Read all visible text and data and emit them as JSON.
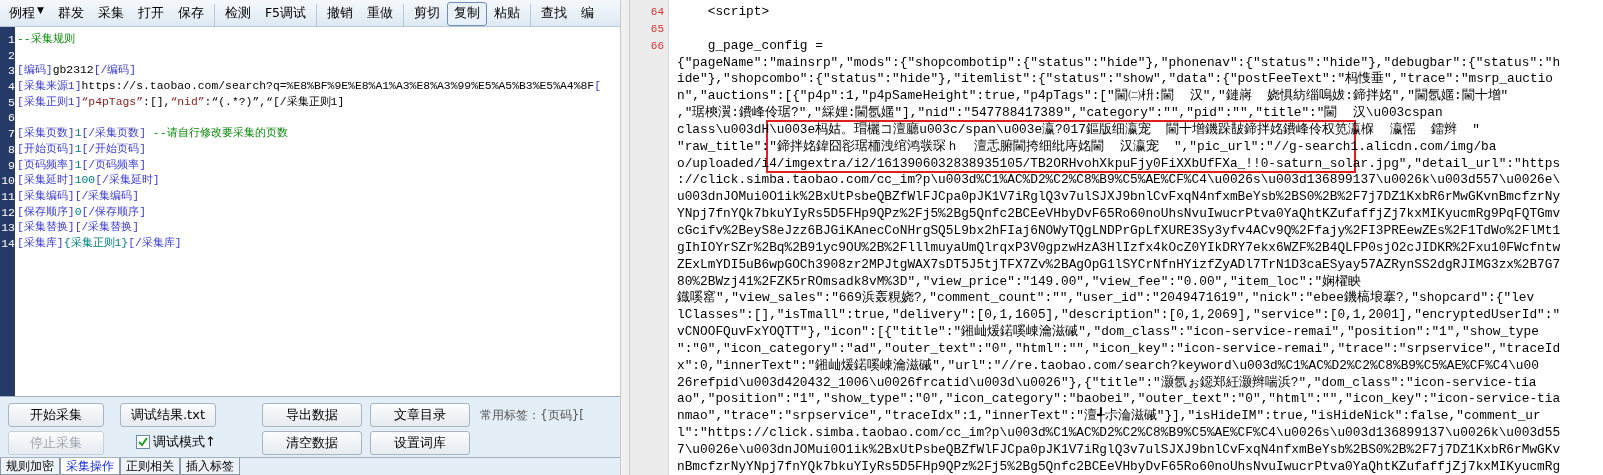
{
  "toolbar": [
    {
      "label": "例程",
      "selected": false,
      "dropdown": "▼"
    },
    {
      "label": "群发",
      "selected": false
    },
    {
      "label": "采集",
      "selected": false
    },
    {
      "label": "打开",
      "selected": false
    },
    {
      "label": "保存",
      "selected": false,
      "sep": true
    },
    {
      "label": "检测",
      "selected": false
    },
    {
      "label": "F5调试",
      "selected": false,
      "sep": true
    },
    {
      "label": "撤销",
      "selected": false
    },
    {
      "label": "重做",
      "selected": false,
      "sep": true
    },
    {
      "label": "剪切",
      "selected": false
    },
    {
      "label": "复制",
      "selected": true
    },
    {
      "label": "粘贴",
      "selected": false,
      "sep": true
    },
    {
      "label": "查找",
      "selected": false
    },
    {
      "label": "编",
      "selected": false
    }
  ],
  "rule_editor": {
    "lines": [
      {
        "number": "1",
        "segments": [
          {
            "kind": "comment",
            "text": "--采集规则"
          }
        ]
      },
      {
        "number": "2"
      },
      {
        "number": "3",
        "segments": [
          {
            "kind": "tag",
            "text": "[编码]"
          },
          {
            "kind": "text",
            "text": "gb2312"
          },
          {
            "kind": "tag",
            "text": "[/编码]"
          }
        ]
      },
      {
        "number": "4",
        "segments": [
          {
            "kind": "tag",
            "text": "[采集来源1]"
          },
          {
            "kind": "text",
            "text": "https://s.taobao.com/search?q=%E8%BF%9E%E8%A1%A3%E8%A3%99%E5%A5%B3%E5%A4%8F"
          },
          {
            "kind": "tag",
            "text": "["
          }
        ]
      },
      {
        "number": "5",
        "segments": [
          {
            "kind": "tag",
            "text": "[采集正则1]"
          },
          {
            "kind": "string",
            "text": "“p4pTags”"
          },
          {
            "kind": "text",
            "text": ":[],"
          },
          {
            "kind": "string",
            "text": "“nid”"
          },
          {
            "kind": "text",
            "text": ":“(.*?)”,“[/采集正则1]"
          }
        ]
      },
      {
        "number": "6"
      },
      {
        "number": "7",
        "segments": [
          {
            "kind": "tag",
            "text": "[采集页数]"
          },
          {
            "kind": "num",
            "text": "1"
          },
          {
            "kind": "tag",
            "text": "[/采集页数]"
          },
          {
            "kind": "comment",
            "text": " --请自行修改要采集的页数"
          }
        ]
      },
      {
        "number": "8",
        "segments": [
          {
            "kind": "tag",
            "text": "[开始页码]"
          },
          {
            "kind": "num",
            "text": "1"
          },
          {
            "kind": "tag",
            "text": "[/开始页码]"
          }
        ]
      },
      {
        "number": "9",
        "segments": [
          {
            "kind": "tag",
            "text": "[页码频率]"
          },
          {
            "kind": "num",
            "text": "1"
          },
          {
            "kind": "tag",
            "text": "[/页码频率]"
          }
        ]
      },
      {
        "number": "10",
        "segments": [
          {
            "kind": "tag",
            "text": "[采集延时]"
          },
          {
            "kind": "num",
            "text": "100"
          },
          {
            "kind": "tag",
            "text": "[/采集延时]"
          }
        ]
      },
      {
        "number": "11",
        "segments": [
          {
            "kind": "tag",
            "text": "[采集编码]"
          },
          {
            "kind": "tag",
            "text": "[/采集编码]"
          }
        ]
      },
      {
        "number": "12",
        "segments": [
          {
            "kind": "tag",
            "text": "[保存顺序]"
          },
          {
            "kind": "num",
            "text": "0"
          },
          {
            "kind": "tag",
            "text": "[/保存顺序]"
          }
        ]
      },
      {
        "number": "13",
        "segments": [
          {
            "kind": "tag",
            "text": "[采集替换]"
          },
          {
            "kind": "tag",
            "text": "[/采集替换]"
          }
        ]
      },
      {
        "number": "14",
        "segments": [
          {
            "kind": "tag",
            "text": "[采集库]"
          },
          {
            "kind": "num",
            "text": "{采集正则1}"
          },
          {
            "kind": "tag",
            "text": "[/采集库]"
          }
        ]
      }
    ]
  },
  "control_panel": {
    "run_buttons": [
      {
        "label": "开始采集",
        "disabled": false
      },
      {
        "label": "停止采集",
        "disabled": true
      }
    ],
    "debug_result_button": {
      "label": "调试结果.txt"
    },
    "data_buttons": [
      {
        "label": "导出数据"
      },
      {
        "label": "文章目录"
      },
      {
        "label": "清空数据"
      },
      {
        "label": "设置词库"
      }
    ],
    "debug_mode": {
      "label": "调试模式↑",
      "checked": true
    },
    "common_tags": "常用标签：{页码}["
  },
  "bottom_tabs": [
    {
      "label": "规则加密",
      "selected": false
    },
    {
      "label": "采集操作",
      "selected": true
    },
    {
      "label": "正则相关",
      "selected": false
    },
    {
      "label": "插入标签",
      "selected": false
    }
  ],
  "source_view": {
    "lines": [
      {
        "number": "64",
        "text": "    <script>"
      },
      {
        "number": "65"
      },
      {
        "number": "66",
        "text": "    g_page_config ="
      },
      {
        "text": "{\"pageName\":\"mainsrp\",\"mods\":{\"shopcombotip\":{\"status\":\"hide\"},\"phonenav\":{\"status\":\"hide\"},\"debugbar\":{\"status\":\"h"
      },
      {
        "text": "ide\"},\"shopcombo\":{\"status\":\"hide\"},\"itemlist\":{\"status\":\"show\",\"data\":{\"postFeeText\":\"杩愯垂\",\"trace\":\"msrp_auctio"
      },
      {
        "text": "n\",\"auctions\":[{\"p4p\":1,\"p4pSameHeight\":true,\"p4pTags\":[\"閫㈡枡:閫  汉\",\"鏈嶈  娆惧紡缁嗚妭:鍗拌姳\",\"閫氬嫟:閫十增\""
      },
      {
        "text": ",\"琚樉瀷:鐨峰伶琚?\",\"綵娌:閫氬嫟\"],\"nid\":\"547788417389\",\"category\":\"\",\"pid\":\"\",\"title\":\"閫  汉\\u003cspan"
      },
      {
        "text": "class\\u003dH\\u003e杩姑。瑁欐コ澶廳u003c/span\\u003e瀛?017鏂版细瀛宠  閫十增鐖跺皵鍗拌姳鐨峰伶权笕瀛椺  瀛愮  鐳辫  \""
      },
      {
        "text": "\"raw_title\":\"鍗拌姳鍏囧彮琚栭洩绾鸿彂琛ｈ  澶忎腑閫挎细纰庤姳閫  汉瀛宠  \",\"pic_url\":\"//g-search1.alicdn.com/img/ba"
      },
      {
        "text": "o/uploaded/i4/imgextra/i2/1613906032838935105/TB2ORHvohXkpuFjy0FiXXbUfFXa_!!0-saturn_solar.jpg\",\"detail_url\":\"https"
      },
      {
        "text": "://click.simba.taobao.com/cc_im?p\\u003d%C1%AC%D2%C2%C8%B9%C5%AE%CF%C4\\u0026s\\u003d136899137\\u0026k\\u003d557\\u0026e\\"
      },
      {
        "text": "u003dnJOMui0O1ik%2BxUtPsbeQBZfWlFJCpa0pJK1V7iRglQ3v7ulSJXJ9bnlCvFxqN4nfxmBeYsb%2BS0%2B%2F7j7DZ1KxbR6rMwGKvnBmcfzrNy"
      },
      {
        "text": "YNpj7fnYQk7bkuYIyRs5D5FHp9QPz%2Fj5%2Bg5Qnfc2BCEeVHbyDvF65Ro60noUhsNvuIwucrPtva0YaQhtKZufaffjZj7kxMIKyucmRg9PqFQTGmv"
      },
      {
        "text": "cGcifv%2BeyS8eJzz6BJGiKAnecCoNHrgSQ5L9bx2hFIaj6NOWyTQgLNDPrGpLfXURE3Sy3yfv4ACv9Q%2Ffajy%2FI3PREewZEs%2F1TdWo%2FlMt1"
      },
      {
        "text": "gIhIOYrSZr%2Bq%2B91yc9OU%2B%2FlllmuyaUmQlrqxP3V0gpzwHzA3HlIzfx4kOcZ0YIkDRY7ekx6WZF%2B4QLFP0sjO2cJIDKR%2Fxu10FWcfntw"
      },
      {
        "text": "ZExLmYDI5uB6wpGOCh3908zr2MPJtgWAX7sDT5J5tjTFX7Zv%2BAgOpG1lSYCrNfnHYizfZyADl7TrN1D3caESyay57AZRynSS2dgRJIMG3zx%2B7G7"
      },
      {
        "text": "80%2BWzj41%2FZK5rROmsadk8vM%3D\",\"view_price\":\"149.00\",\"view_fee\":\"0.00\",\"item_loc\":\"娴櫂眏"
      },
      {
        "text": "鐡嗘窰\",\"view_sales\":\"669浜轰粯娆?,\"comment_count\":\"\",\"user_id\":\"2049471619\",\"nick\":\"ebee鐖槁埌搴?,\"shopcard\":{\"lev"
      },
      {
        "text": "lClasses\":[],\"isTmall\":true,\"delivery\":[0,1,1605],\"description\":[0,1,2069],\"service\":[0,1,2001],\"encryptedUserId\":\""
      },
      {
        "text": "vCNOOFQuvFxYOQTT\"},\"icon\":[{\"title\":\"鎺屾煖鍩嗘崠瀹滋磩\",\"dom_class\":\"icon-service-remai\",\"position\":\"1\",\"show_type"
      },
      {
        "text": "\":\"0\",\"icon_category\":\"ad\",\"outer_text\":\"0\",\"html\":\"\",\"icon_key\":\"icon-service-remai\",\"trace\":\"srpservice\",\"traceId"
      },
      {
        "text": "x\":0,\"innerText\":\"鎺屾煖鍩嗘崠瀹滋磩\",\"url\":\"//re.taobao.com/search?keyword\\u003d%C1%AC%D2%C2%C8%B9%C5%AE%CF%C4\\u00"
      },
      {
        "text": "26refpid\\u003d420432_1006\\u0026frcatid\\u003d\\u0026\"},{\"title\":\"灏氬ぉ鐚郑紝灏辫喘浜?\",\"dom_class\":\"icon-service-tia"
      },
      {
        "text": "ao\",\"position\":\"1\",\"show_type\":\"0\",\"icon_category\":\"baobei\",\"outer_text\":\"0\",\"html\":\"\",\"icon_key\":\"icon-service-tia"
      },
      {
        "text": "nmao\",\"trace\":\"srpservice\",\"traceIdx\":1,\"innerText\":\"澶╃尗淪滋磩\"}],\"isHideIM\":true,\"isHideNick\":false,\"comment_ur"
      },
      {
        "text": "l\":\"https://click.simba.taobao.com/cc_im?p\\u003d%C1%AC%D2%C2%C8%B9%C5%AE%CF%C4\\u0026s\\u003d136899137\\u0026k\\u003d55"
      },
      {
        "text": "7\\u0026e\\u003dnJOMui0O1ik%2BxUtPsbeQBZfWlFJCpa0pJK1V7iRglQ3v7ulSJXJ9bnlCvFxqN4nfxmBeYsb%2BS0%2B%2F7j7DZ1KxbR6rMwGKv"
      },
      {
        "text": "nBmcfzrNyYNpj7fnYQk7bkuYIyRs5D5FHp9QPz%2Fj5%2Bg5Qnfc2BCEeVHbyDvF65Ro60noUhsNvuIwucrPtva0YaQhtKZufaffjZj7kxMIKyucmRg"
      }
    ]
  }
}
